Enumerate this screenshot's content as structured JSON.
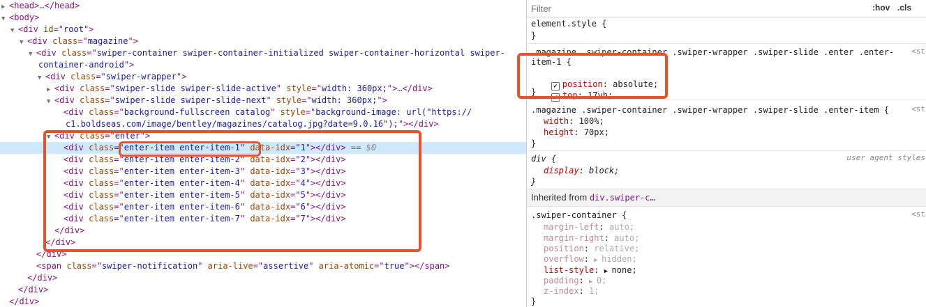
{
  "elements_tree": {
    "lines": [
      {
        "indent": 0,
        "tw": "▶",
        "segs": [
          [
            "t",
            "<head>"
          ],
          [
            "m",
            "…"
          ],
          [
            "t",
            "</head>"
          ]
        ]
      },
      {
        "indent": 0,
        "tw": "▼",
        "segs": [
          [
            "t",
            "<body>"
          ]
        ]
      },
      {
        "indent": 1,
        "tw": "▼",
        "segs": [
          [
            "t",
            "<div "
          ],
          [
            "a",
            "id"
          ],
          [
            "t",
            "=\""
          ],
          [
            "v",
            "root"
          ],
          [
            "t",
            "\">"
          ]
        ]
      },
      {
        "indent": 2,
        "tw": "▼",
        "segs": [
          [
            "t",
            "<div "
          ],
          [
            "a",
            "class"
          ],
          [
            "t",
            "=\""
          ],
          [
            "v",
            "magazine"
          ],
          [
            "t",
            "\">"
          ]
        ]
      },
      {
        "indent": 3,
        "tw": "▼",
        "segs": [
          [
            "t",
            "<div "
          ],
          [
            "a",
            "class"
          ],
          [
            "t",
            "=\""
          ],
          [
            "v",
            "swiper-container swiper-container-initialized swiper-container-horizontal swiper-"
          ]
        ]
      },
      {
        "indent": 3,
        "tw": "",
        "cont": true,
        "segs": [
          [
            "v",
            "container-android"
          ],
          [
            "t",
            "\">"
          ]
        ]
      },
      {
        "indent": 4,
        "tw": "▼",
        "segs": [
          [
            "t",
            "<div "
          ],
          [
            "a",
            "class"
          ],
          [
            "t",
            "=\""
          ],
          [
            "v",
            "swiper-wrapper"
          ],
          [
            "t",
            "\">"
          ]
        ]
      },
      {
        "indent": 5,
        "tw": "▶",
        "segs": [
          [
            "t",
            "<div "
          ],
          [
            "a",
            "class"
          ],
          [
            "t",
            "=\""
          ],
          [
            "v",
            "swiper-slide swiper-slide-active"
          ],
          [
            "t",
            "\" "
          ],
          [
            "a",
            "style"
          ],
          [
            "t",
            "=\""
          ],
          [
            "v",
            "width: 360px;"
          ],
          [
            "t",
            "\">"
          ],
          [
            "m",
            "…"
          ],
          [
            "t",
            "</div>"
          ]
        ]
      },
      {
        "indent": 5,
        "tw": "▼",
        "segs": [
          [
            "t",
            "<div "
          ],
          [
            "a",
            "class"
          ],
          [
            "t",
            "=\""
          ],
          [
            "v",
            "swiper-slide swiper-slide-next"
          ],
          [
            "t",
            "\" "
          ],
          [
            "a",
            "style"
          ],
          [
            "t",
            "=\""
          ],
          [
            "v",
            "width: 360px;"
          ],
          [
            "t",
            "\">"
          ]
        ]
      },
      {
        "indent": 6,
        "tw": "",
        "segs": [
          [
            "t",
            "<div "
          ],
          [
            "a",
            "class"
          ],
          [
            "t",
            "=\""
          ],
          [
            "v",
            "background-fullscreen catalog"
          ],
          [
            "t",
            "\" "
          ],
          [
            "a",
            "style"
          ],
          [
            "t",
            "=\""
          ],
          [
            "v",
            "background-image: url(\"https://"
          ]
        ]
      },
      {
        "indent": 6,
        "tw": "",
        "cont": true,
        "segs": [
          [
            "v",
            "c1.boldseas.com/image/bentley/magazines/catalog.jpg?date=9.0.16\");"
          ],
          [
            "t",
            "\">"
          ],
          [
            "t",
            "</div>"
          ]
        ]
      },
      {
        "indent": 5,
        "tw": "▼",
        "segs": [
          [
            "t",
            "<div "
          ],
          [
            "a",
            "class"
          ],
          [
            "t",
            "=\""
          ],
          [
            "v",
            "enter"
          ],
          [
            "t",
            "\">"
          ]
        ]
      },
      {
        "indent": 6,
        "tw": "",
        "sel": true,
        "segs": [
          [
            "t",
            "<div "
          ],
          [
            "a",
            "class"
          ],
          [
            "t",
            "=\""
          ],
          [
            "v",
            "enter-item enter-item-1"
          ],
          [
            "t",
            "\" "
          ],
          [
            "a",
            "data-idx"
          ],
          [
            "t",
            "=\""
          ],
          [
            "v",
            "1"
          ],
          [
            "t",
            "\">"
          ],
          [
            "t",
            "</div>"
          ],
          [
            "m",
            " == "
          ],
          [
            "d",
            "$0"
          ]
        ]
      },
      {
        "indent": 6,
        "tw": "",
        "segs": [
          [
            "t",
            "<div "
          ],
          [
            "a",
            "class"
          ],
          [
            "t",
            "=\""
          ],
          [
            "v",
            "enter-item enter-item-2"
          ],
          [
            "t",
            "\" "
          ],
          [
            "a",
            "data-idx"
          ],
          [
            "t",
            "=\""
          ],
          [
            "v",
            "2"
          ],
          [
            "t",
            "\">"
          ],
          [
            "t",
            "</div>"
          ]
        ]
      },
      {
        "indent": 6,
        "tw": "",
        "segs": [
          [
            "t",
            "<div "
          ],
          [
            "a",
            "class"
          ],
          [
            "t",
            "=\""
          ],
          [
            "v",
            "enter-item enter-item-3"
          ],
          [
            "t",
            "\" "
          ],
          [
            "a",
            "data-idx"
          ],
          [
            "t",
            "=\""
          ],
          [
            "v",
            "3"
          ],
          [
            "t",
            "\">"
          ],
          [
            "t",
            "</div>"
          ]
        ]
      },
      {
        "indent": 6,
        "tw": "",
        "segs": [
          [
            "t",
            "<div "
          ],
          [
            "a",
            "class"
          ],
          [
            "t",
            "=\""
          ],
          [
            "v",
            "enter-item enter-item-4"
          ],
          [
            "t",
            "\" "
          ],
          [
            "a",
            "data-idx"
          ],
          [
            "t",
            "=\""
          ],
          [
            "v",
            "4"
          ],
          [
            "t",
            "\">"
          ],
          [
            "t",
            "</div>"
          ]
        ]
      },
      {
        "indent": 6,
        "tw": "",
        "segs": [
          [
            "t",
            "<div "
          ],
          [
            "a",
            "class"
          ],
          [
            "t",
            "=\""
          ],
          [
            "v",
            "enter-item enter-item-5"
          ],
          [
            "t",
            "\" "
          ],
          [
            "a",
            "data-idx"
          ],
          [
            "t",
            "=\""
          ],
          [
            "v",
            "5"
          ],
          [
            "t",
            "\">"
          ],
          [
            "t",
            "</div>"
          ]
        ]
      },
      {
        "indent": 6,
        "tw": "",
        "segs": [
          [
            "t",
            "<div "
          ],
          [
            "a",
            "class"
          ],
          [
            "t",
            "=\""
          ],
          [
            "v",
            "enter-item enter-item-6"
          ],
          [
            "t",
            "\" "
          ],
          [
            "a",
            "data-idx"
          ],
          [
            "t",
            "=\""
          ],
          [
            "v",
            "6"
          ],
          [
            "t",
            "\">"
          ],
          [
            "t",
            "</div>"
          ]
        ]
      },
      {
        "indent": 6,
        "tw": "",
        "segs": [
          [
            "t",
            "<div "
          ],
          [
            "a",
            "class"
          ],
          [
            "t",
            "=\""
          ],
          [
            "v",
            "enter-item enter-item-7"
          ],
          [
            "t",
            "\" "
          ],
          [
            "a",
            "data-idx"
          ],
          [
            "t",
            "=\""
          ],
          [
            "v",
            "7"
          ],
          [
            "t",
            "\">"
          ],
          [
            "t",
            "</div>"
          ]
        ]
      },
      {
        "indent": 5,
        "tw": "",
        "segs": [
          [
            "t",
            "</div>"
          ]
        ]
      },
      {
        "indent": 4,
        "tw": "",
        "segs": [
          [
            "t",
            "</div>"
          ]
        ]
      },
      {
        "indent": 3,
        "tw": "",
        "segs": [
          [
            "t",
            "</div>"
          ]
        ]
      },
      {
        "indent": 3,
        "tw": "",
        "segs": [
          [
            "t",
            "<span "
          ],
          [
            "a",
            "class"
          ],
          [
            "t",
            "=\""
          ],
          [
            "v",
            "swiper-notification"
          ],
          [
            "t",
            "\" "
          ],
          [
            "a",
            "aria-live"
          ],
          [
            "t",
            "=\""
          ],
          [
            "v",
            "assertive"
          ],
          [
            "t",
            "\" "
          ],
          [
            "a",
            "aria-atomic"
          ],
          [
            "t",
            "=\""
          ],
          [
            "v",
            "true"
          ],
          [
            "t",
            "\">"
          ],
          [
            "t",
            "</span>"
          ]
        ]
      },
      {
        "indent": 2,
        "tw": "",
        "segs": [
          [
            "t",
            "</div>"
          ]
        ]
      },
      {
        "indent": 1,
        "tw": "",
        "segs": [
          [
            "t",
            "</div>"
          ]
        ]
      },
      {
        "indent": 0,
        "tw": "",
        "segs": [
          [
            "t",
            "</div>"
          ]
        ]
      }
    ]
  },
  "styles": {
    "filter_placeholder": "Filter",
    "hov_label": ":hov",
    "cls_label": ".cls",
    "element_style": {
      "selector": "element.style {",
      "close": "}"
    },
    "rule1": {
      "selector_line1": ".magazine .swiper-container .swiper-wrapper .swiper-slide .enter .enter-",
      "selector_line2": "item-1 {",
      "source": "<st",
      "props": [
        {
          "name": "position",
          "value": "absolute;",
          "checked": true
        },
        {
          "name": "top",
          "value": "17vh;",
          "checked": true
        }
      ],
      "close": "}"
    },
    "rule2": {
      "selector": ".magazine .swiper-container .swiper-wrapper .swiper-slide .enter-item {",
      "source": "<st",
      "props": [
        {
          "name": "width",
          "value": "100%;"
        },
        {
          "name": "height",
          "value": "70px;"
        }
      ],
      "close": "}"
    },
    "rule3": {
      "selector": "div {",
      "source": "user agent styles",
      "props": [
        {
          "name": "display",
          "value": "block;"
        }
      ],
      "close": "}"
    },
    "inherited": {
      "label": "Inherited from ",
      "link": "div.swiper-c…"
    },
    "rule4": {
      "selector": ".swiper-container {",
      "source": "<st",
      "props": [
        {
          "name": "margin-left",
          "value": "auto;",
          "dim": true
        },
        {
          "name": "margin-right",
          "value": "auto;",
          "dim": true
        },
        {
          "name": "position",
          "value": "relative;",
          "dim": true
        },
        {
          "name": "overflow",
          "value": "hidden;",
          "dim": true,
          "arrow": true
        },
        {
          "name": "list-style",
          "value": "none;",
          "dim": false,
          "arrow": true
        },
        {
          "name": "padding",
          "value": "0;",
          "dim": true,
          "arrow": true
        },
        {
          "name": "z-index",
          "value": "1;",
          "dim": true
        }
      ],
      "close": "}"
    }
  },
  "colors": {
    "highlight": "#e0552e",
    "selected_row": "#cfe8fc"
  }
}
